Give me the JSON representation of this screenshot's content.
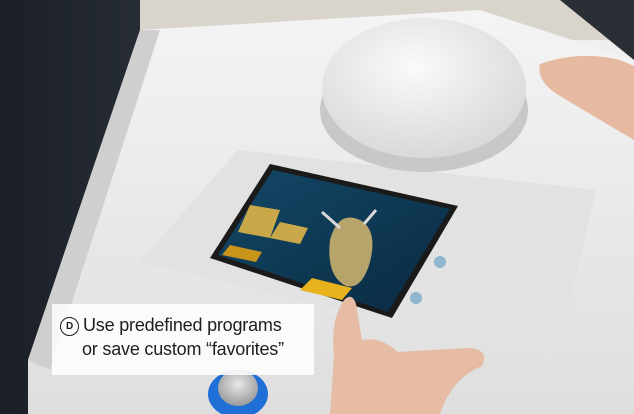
{
  "callout": {
    "marker": "D",
    "line1": "Use predefined programs",
    "line2": "or save custom “favorites”"
  },
  "colors": {
    "screen_bg": "#0f3a56",
    "accent_yellow": "#e8b21c",
    "device_body": "#e9e9e9",
    "knob_ring": "#1f6fd6"
  },
  "icons": [
    "organ-illustration-icon",
    "menu-button-icon"
  ]
}
